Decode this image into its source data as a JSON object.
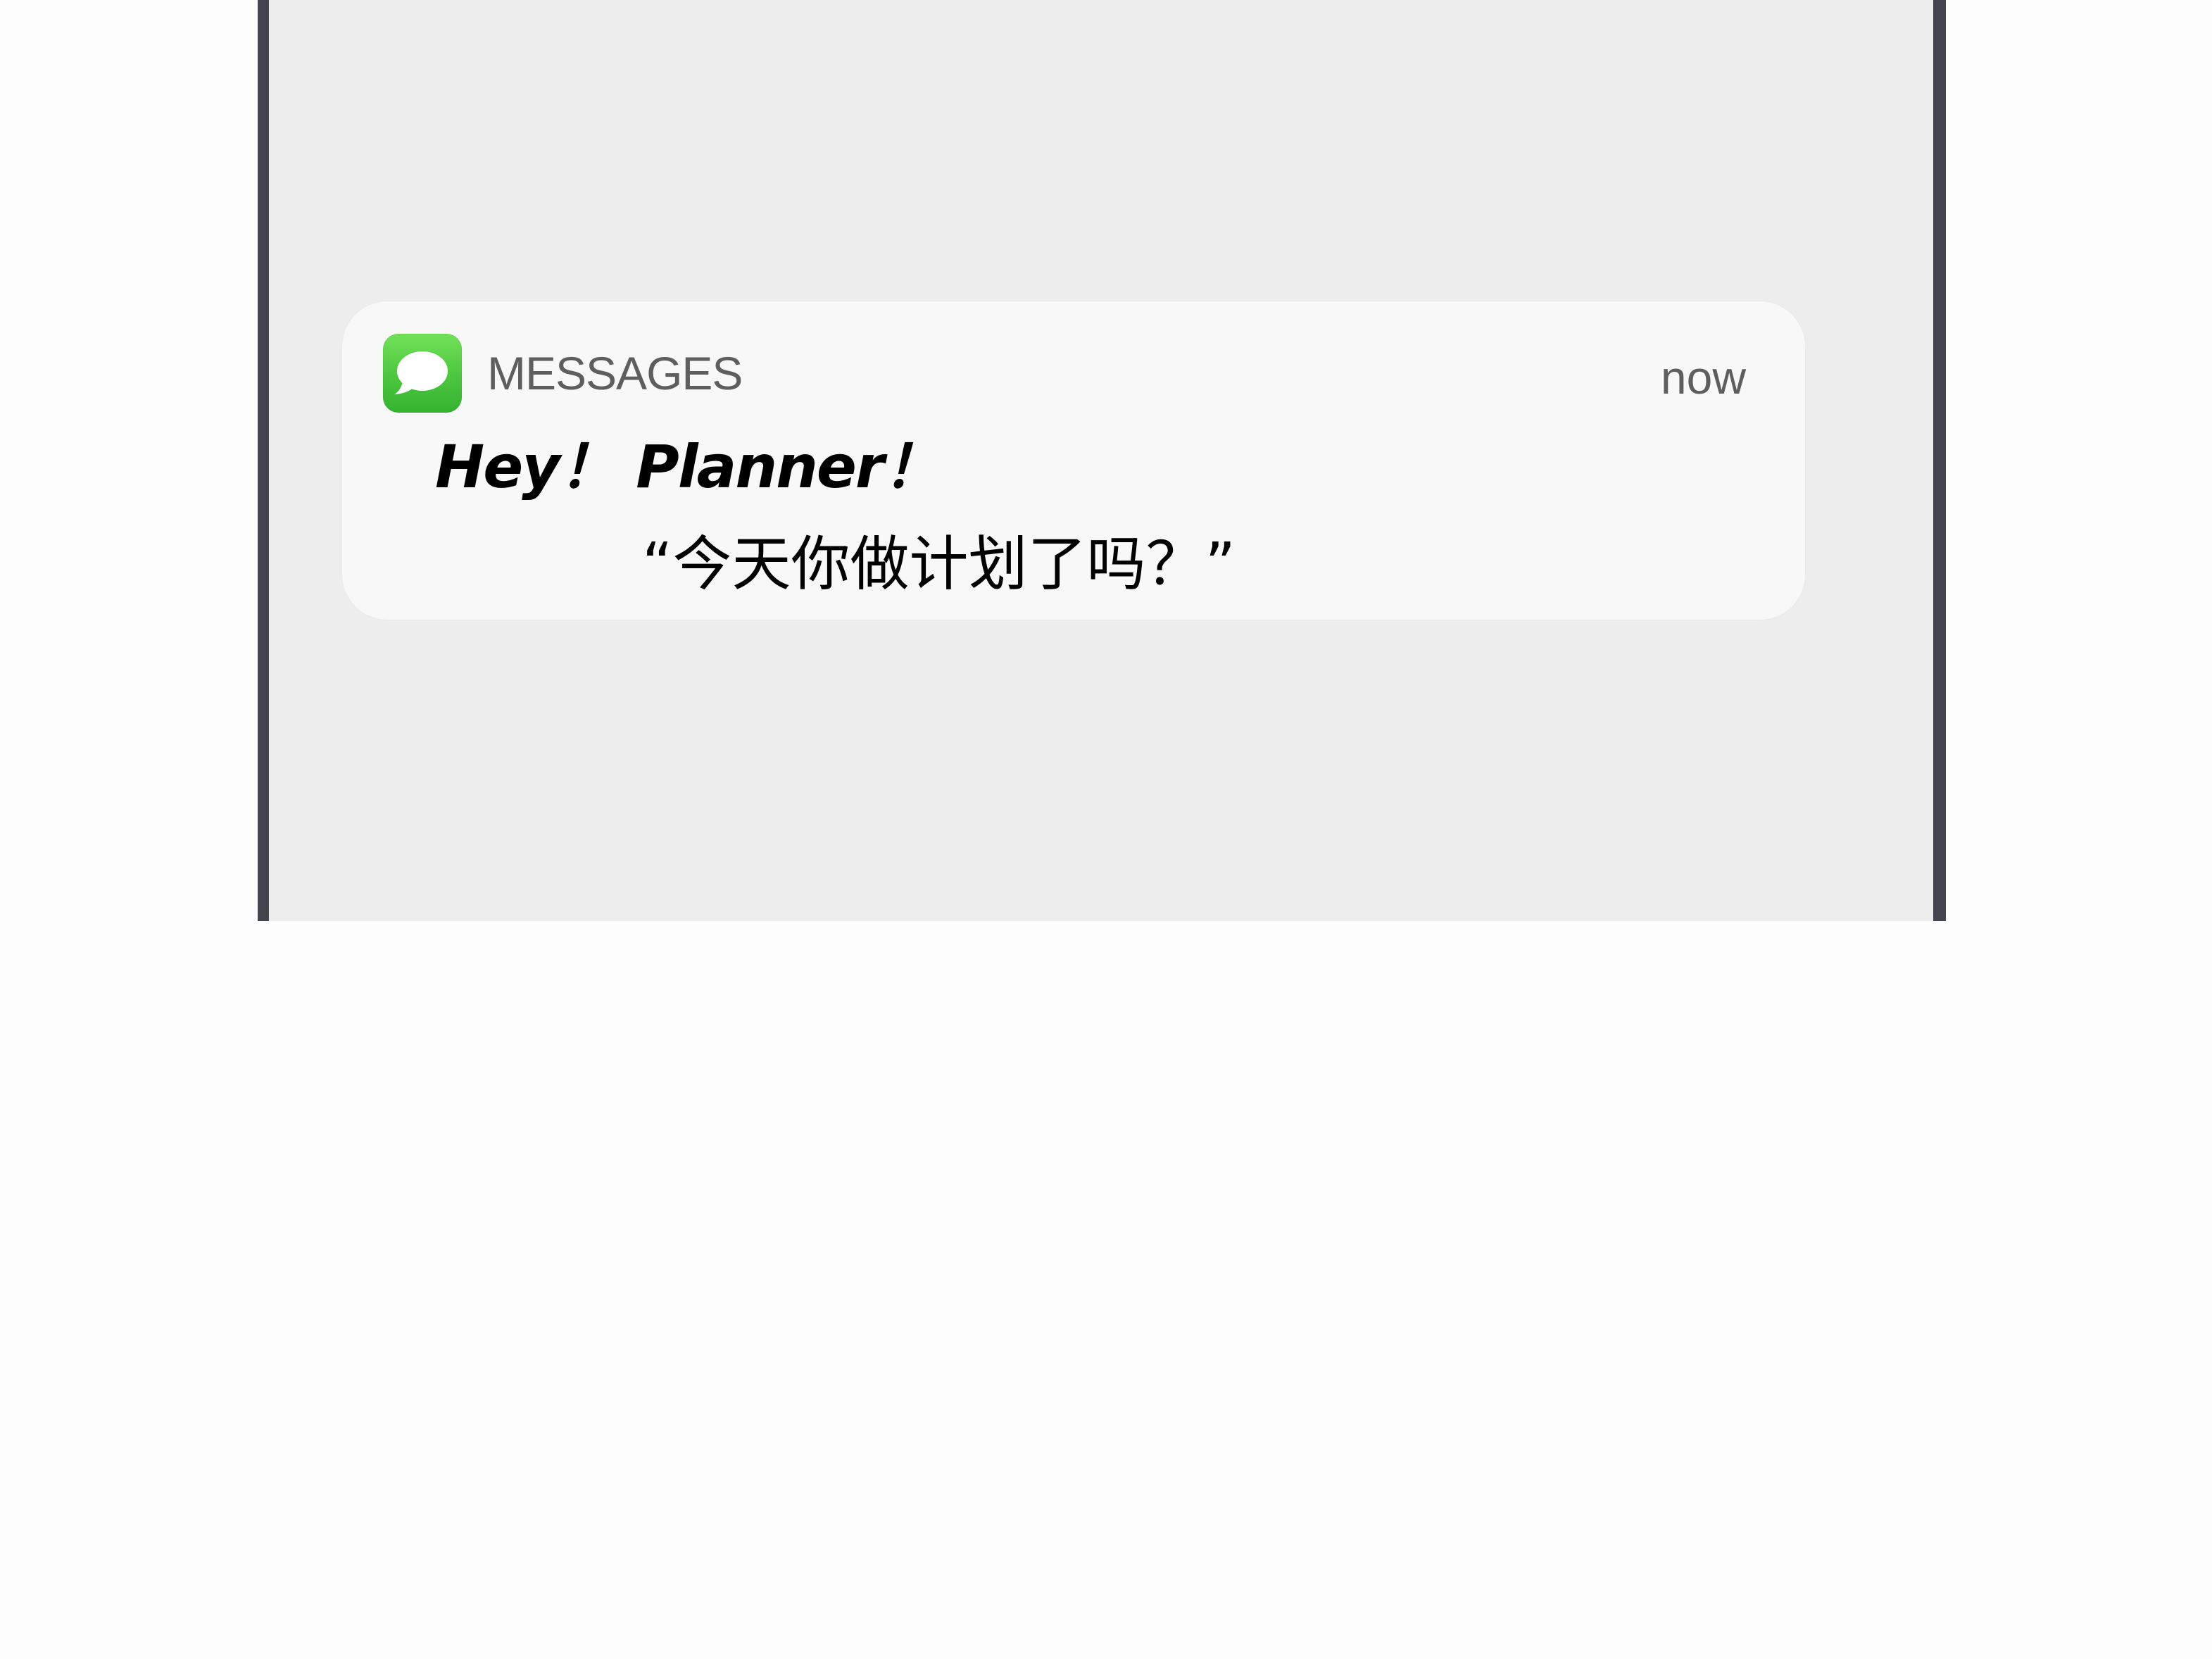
{
  "notification": {
    "app_name": "MESSAGES",
    "timestamp": "now",
    "title": "Hey！ Planner！",
    "body": "“今天你做计划了吗？”",
    "icon": "messages-app-icon"
  },
  "colors": {
    "phone_frame": "#45454f",
    "screen_background": "#ededed",
    "notification_background": "#f8f8f8",
    "icon_green": "#4cc63e",
    "secondary_text": "#5e5e5e"
  }
}
